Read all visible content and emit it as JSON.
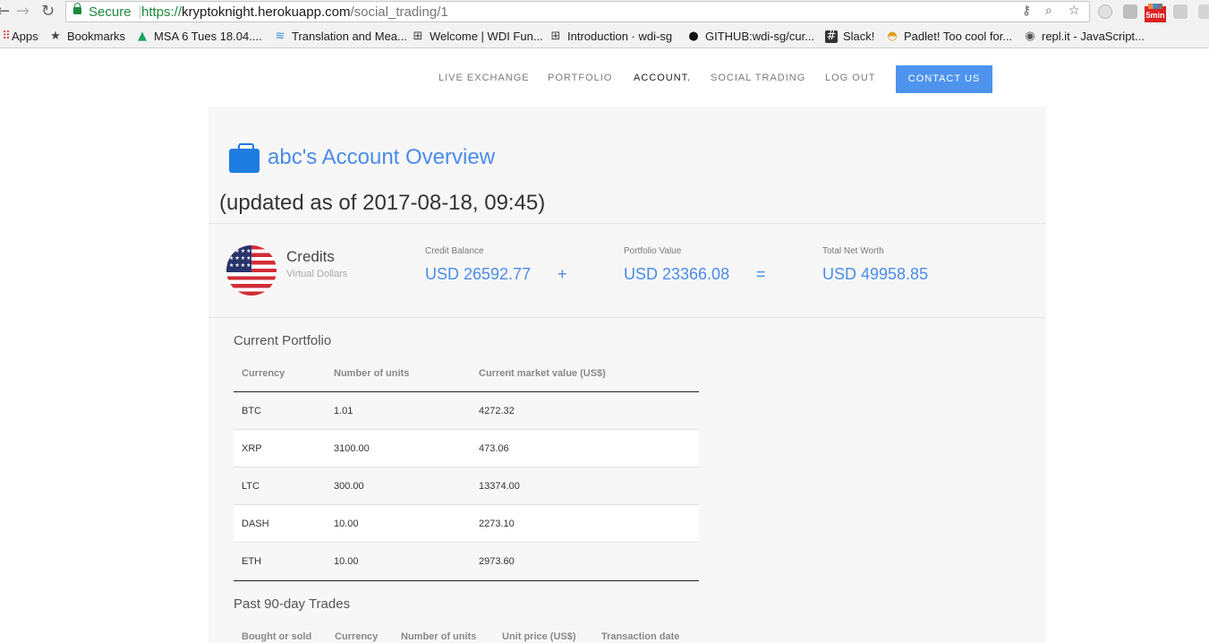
{
  "browser": {
    "secure_label": "Secure",
    "url_scheme": "https://",
    "url_host": "kryptoknight.herokuapp.com",
    "url_path": "/social_trading/1",
    "ext_badge": "5min",
    "bookmarks": [
      {
        "label": "Apps",
        "icon": "apps-grid-icon"
      },
      {
        "label": "Bookmarks",
        "icon": "star-icon"
      },
      {
        "label": "MSA 6 Tues 18.04....",
        "icon": "google-drive-icon"
      },
      {
        "label": "Translation and Mea...",
        "icon": "book-stack-icon"
      },
      {
        "label": "Welcome | WDI Fun...",
        "icon": "gitbook-icon"
      },
      {
        "label": "Introduction · wdi-sg",
        "icon": "gitbook-icon"
      },
      {
        "label": "GITHUB:wdi-sg/cur...",
        "icon": "github-icon"
      },
      {
        "label": "Slack!",
        "icon": "hash-icon"
      },
      {
        "label": "Padlet! Too cool for...",
        "icon": "padlet-icon"
      },
      {
        "label": "repl.it - JavaScript...",
        "icon": "replit-icon"
      }
    ]
  },
  "nav": {
    "links": [
      "LIVE EXCHANGE",
      "PORTFOLIO",
      "ACCOUNT.",
      "SOCIAL TRADING",
      "LOG OUT"
    ],
    "contact": "CONTACT US"
  },
  "account": {
    "title": "abc's Account Overview",
    "updated": "(updated as of 2017-08-18, 09:45)",
    "credits_label": "Credits",
    "credits_sub": "Virtual Dollars",
    "credit_balance_label": "Credit Balance",
    "credit_balance": "USD 26592.77",
    "plus": "+",
    "portfolio_value_label": "Portfolio Value",
    "portfolio_value": "USD 23366.08",
    "equals": "=",
    "net_worth_label": "Total Net Worth",
    "net_worth": "USD 49958.85"
  },
  "portfolio": {
    "heading": "Current Portfolio",
    "columns": [
      "Currency",
      "Number of units",
      "Current market value (US$)"
    ],
    "rows": [
      [
        "BTC",
        "1.01",
        "4272.32"
      ],
      [
        "XRP",
        "3100.00",
        "473.06"
      ],
      [
        "LTC",
        "300.00",
        "13374.00"
      ],
      [
        "DASH",
        "10.00",
        "2273.10"
      ],
      [
        "ETH",
        "10.00",
        "2973.60"
      ]
    ]
  },
  "trades": {
    "heading": "Past 90-day Trades",
    "columns": [
      "Bought or sold",
      "Currency",
      "Number of units",
      "Unit price (US$)",
      "Transaction date"
    ]
  }
}
